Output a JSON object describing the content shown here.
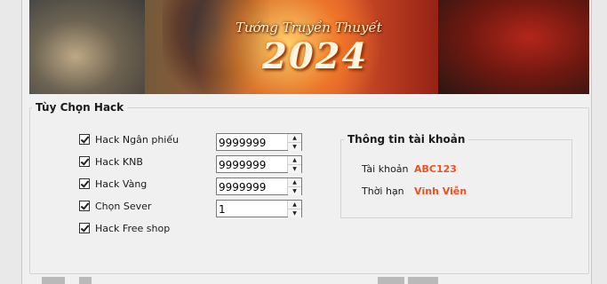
{
  "banner": {
    "title": "Tướng Truyền Thuyết",
    "year": "2024"
  },
  "hack_group": {
    "title": "Tùy Chọn Hack",
    "options": [
      {
        "label": "Hack Ngân phiếu",
        "checked": true
      },
      {
        "label": "Hack KNB",
        "checked": true
      },
      {
        "label": "Hack Vàng",
        "checked": true
      },
      {
        "label": "Chọn Sever",
        "checked": true
      },
      {
        "label": "Hack Free shop",
        "checked": true
      }
    ],
    "values": [
      "9999999",
      "9999999",
      "9999999",
      "1"
    ]
  },
  "account": {
    "title": "Thông tin tài khoản",
    "account_label": "Tài khoản",
    "account_value": "ABC123",
    "expiry_label": "Thời hạn",
    "expiry_value": "Vĩnh Viễn"
  },
  "colors": {
    "accent": "#f0501e",
    "window_bg": "#f0f0f0"
  },
  "icons": {
    "spin_up": "triangle-up",
    "spin_down": "triangle-down",
    "checkbox": "check-mark"
  }
}
